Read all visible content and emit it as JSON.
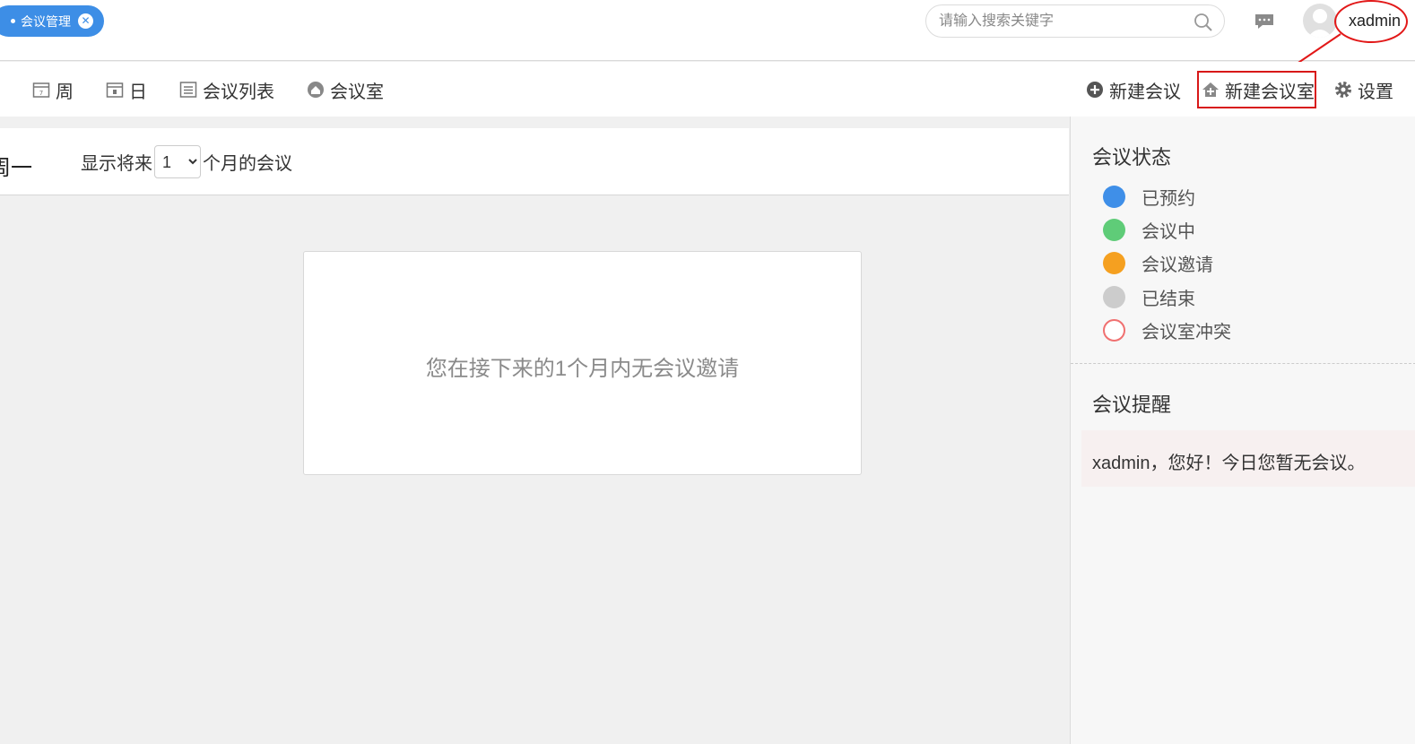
{
  "header": {
    "tab_label": "会议管理",
    "search_placeholder": "请输入搜索关键字",
    "username": "xadmin"
  },
  "toolbar": {
    "week": "周",
    "day": "日",
    "meeting_list": "会议列表",
    "meeting_room": "会议室",
    "new_meeting": "新建会议",
    "new_room": "新建会议室",
    "settings": "设置"
  },
  "main": {
    "week_label": "周一",
    "range_prefix": "显示将来",
    "range_value": "1",
    "range_suffix": "个月的会议",
    "empty_message": "您在接下来的1个月内无会议邀请"
  },
  "sidebar": {
    "status_title": "会议状态",
    "statuses": [
      {
        "label": "已预约",
        "color": "#3f8fe8"
      },
      {
        "label": "会议中",
        "color": "#5fcc78"
      },
      {
        "label": "会议邀请",
        "color": "#f5a020"
      },
      {
        "label": "已结束",
        "color": "#cccccc"
      },
      {
        "label": "会议室冲突",
        "color": "#f07070"
      }
    ],
    "reminder_title": "会议提醒",
    "reminder_text": "xadmin，您好！今日您暂无会议。"
  }
}
